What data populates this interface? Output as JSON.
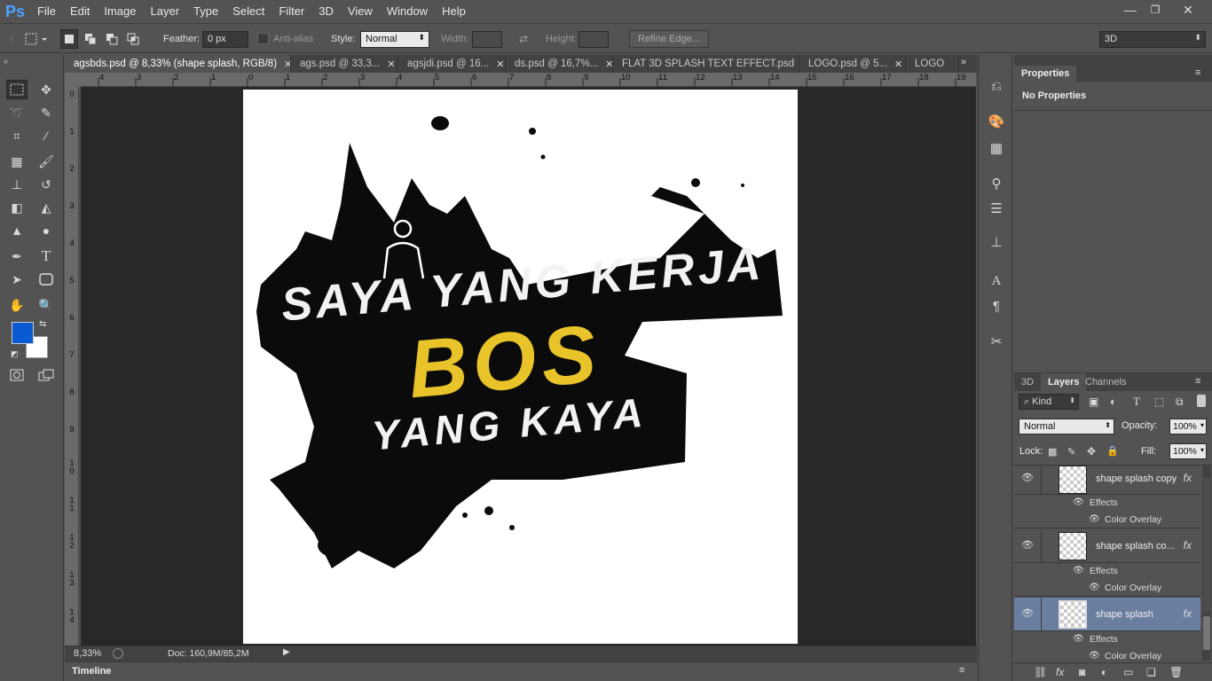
{
  "app": {
    "logo": "Ps"
  },
  "menu": [
    "File",
    "Edit",
    "Image",
    "Layer",
    "Type",
    "Select",
    "Filter",
    "3D",
    "View",
    "Window",
    "Help"
  ],
  "window_controls": {
    "minimize": "—",
    "restore": "❐",
    "close": "✕"
  },
  "options": {
    "feather_label": "Feather:",
    "feather_value": "0 px",
    "antialias_label": "Anti-alias",
    "style_label": "Style:",
    "style_value": "Normal",
    "width_label": "Width:",
    "height_label": "Height:",
    "refine_edge": "Refine Edge...",
    "workspace": "3D"
  },
  "tabs": [
    {
      "label": "agsbds.psd @ 8,33% (shape splash, RGB/8)",
      "active": true
    },
    {
      "label": "ags.psd @ 33,3..."
    },
    {
      "label": "agsjdi.psd @ 16..."
    },
    {
      "label": "ds.psd @ 16,7%..."
    },
    {
      "label": "FLAT 3D SPLASH TEXT EFFECT.psd"
    },
    {
      "label": "LOGO.psd @ 5..."
    },
    {
      "label": "LOGO"
    }
  ],
  "ruler": {
    "h": [
      "4",
      "3",
      "2",
      "1",
      "0",
      "1",
      "2",
      "3",
      "4",
      "5",
      "6",
      "7",
      "8",
      "9",
      "10",
      "11",
      "12",
      "13",
      "14",
      "15",
      "16",
      "17",
      "18",
      "19"
    ],
    "v": [
      "0",
      "1",
      "2",
      "3",
      "4",
      "5",
      "6",
      "7",
      "8",
      "9",
      "1 0",
      "1 1",
      "1 2",
      "1 3",
      "1 4"
    ]
  },
  "artwork": {
    "line1": "SAYA YANG KERJA",
    "line2": "BOS",
    "line3": "YANG KAYA",
    "accent": "#e8c42a"
  },
  "status": {
    "zoom": "8,33%",
    "doc": "Doc: 160,9M/85,2M"
  },
  "timeline": {
    "label": "Timeline"
  },
  "properties": {
    "title": "Properties",
    "empty": "No Properties"
  },
  "layers_panel": {
    "tabs": [
      "3D",
      "Layers",
      "Channels"
    ],
    "filter_kind": "Kind",
    "blend_mode": "Normal",
    "opacity_label": "Opacity:",
    "opacity_value": "100%",
    "lock_label": "Lock:",
    "fill_label": "Fill:",
    "fill_value": "100%",
    "layers": [
      {
        "name": "shape splash copy",
        "effects": "Effects",
        "effect": "Color Overlay",
        "selected": false
      },
      {
        "name": "shape splash co...",
        "effects": "Effects",
        "effect": "Color Overlay",
        "selected": false
      },
      {
        "name": "shape splash",
        "effects": "Effects",
        "effect": "Color Overlay",
        "selected": true
      }
    ]
  },
  "colors": {
    "foreground": "#0a5bd3",
    "background": "#ffffff",
    "selection": "#6a7fa0"
  }
}
